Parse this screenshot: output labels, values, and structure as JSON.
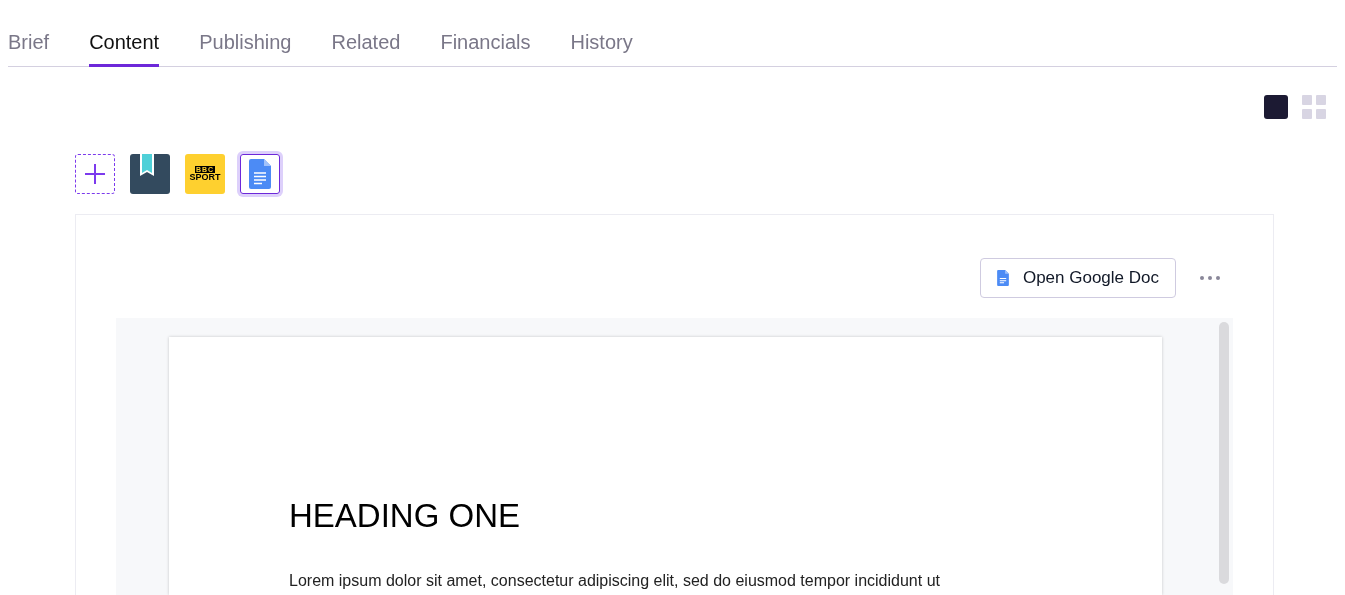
{
  "tabs": [
    {
      "label": "Brief",
      "selected": false
    },
    {
      "label": "Content",
      "selected": true
    },
    {
      "label": "Publishing",
      "selected": false
    },
    {
      "label": "Related",
      "selected": false
    },
    {
      "label": "Financials",
      "selected": false
    },
    {
      "label": "History",
      "selected": false
    }
  ],
  "view_toggle": [
    {
      "kind": "single",
      "selected": true
    },
    {
      "kind": "grid",
      "selected": false
    }
  ],
  "sources": [
    {
      "kind": "add",
      "selected": false
    },
    {
      "kind": "bookmark",
      "selected": false
    },
    {
      "kind": "bbc",
      "selected": false,
      "logo_top": "BBC",
      "logo_bottom": "SPORT"
    },
    {
      "kind": "gdoc",
      "selected": true
    }
  ],
  "open_button": "Open Google Doc",
  "document": {
    "heading": "HEADING ONE",
    "paragraph": "Lorem ipsum dolor sit amet, consectetur adipiscing elit, sed do eiusmod tempor incididunt ut"
  }
}
